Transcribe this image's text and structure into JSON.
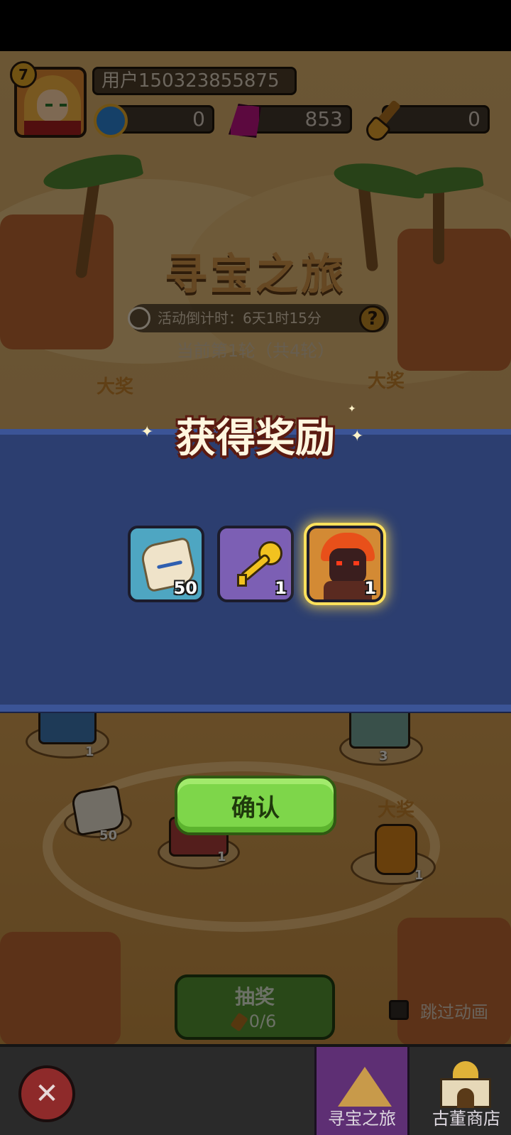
{
  "header": {
    "level": "7",
    "username": "用户150323855875",
    "resources": [
      {
        "name": "coin",
        "icon": "coin-icon",
        "value": "0"
      },
      {
        "name": "gem",
        "icon": "gem-icon",
        "value": "853"
      },
      {
        "name": "shovel",
        "icon": "shovel-icon",
        "value": "0"
      }
    ]
  },
  "event": {
    "title": "寻宝之旅",
    "countdown": "活动倒计时：6天1时15分",
    "round": "当前第1轮（共4轮）",
    "grand_prize_label": "大奖"
  },
  "modal": {
    "title": "获得奖励",
    "rewards": [
      {
        "icon": "rune-stone-icon",
        "count": "50"
      },
      {
        "icon": "golden-key-icon",
        "count": "1"
      },
      {
        "icon": "fire-demon-hero-icon",
        "count": "1"
      }
    ],
    "confirm_label": "确认"
  },
  "map": {
    "items": [
      {
        "icon": "mystery-chest-icon",
        "count": "1"
      },
      {
        "icon": "silver-chest-icon",
        "count": "3"
      },
      {
        "icon": "rune-stone-icon",
        "count": "50"
      },
      {
        "icon": "red-chest-icon",
        "count": "1"
      },
      {
        "icon": "amber-gem-icon",
        "count": "1"
      }
    ],
    "grand_prize_label": "大奖"
  },
  "controls": {
    "lottery_label": "抽奖",
    "lottery_count": "0/6",
    "skip_animation_label": "跳过动画"
  },
  "nav": {
    "tabs": [
      {
        "label": "寻宝之旅",
        "active": true
      },
      {
        "label": "古董商店",
        "active": false
      }
    ]
  },
  "colors": {
    "modal_bg": "#2c3e70",
    "confirm_green": "#7ed64a",
    "active_tab": "#5e2f74"
  }
}
